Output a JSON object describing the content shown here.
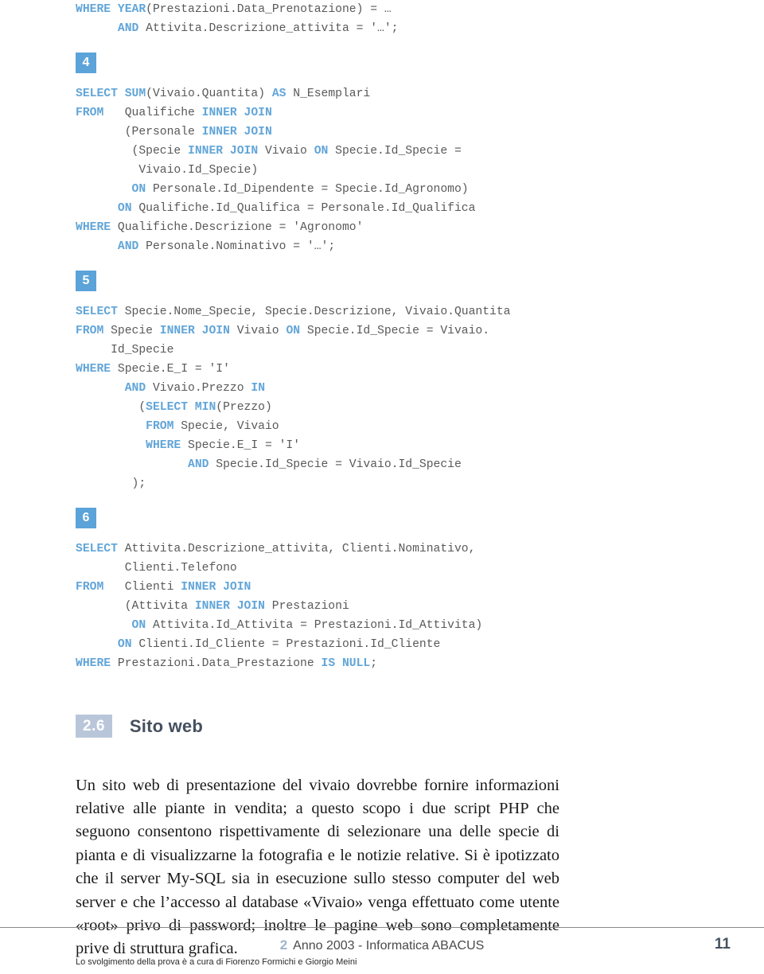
{
  "document": {
    "page_number": "11",
    "footer_chapter": "2",
    "footer_title": "Anno 2003 - Informatica ABACUS",
    "credit": "Lo svolgimento della prova è a cura di Fiorenzo Formichi e Giorgio Meini"
  },
  "colors": {
    "sql_keyword": "#61a5d8",
    "sql_text": "#59595b",
    "badge_bg": "#5ba3d9",
    "section_num_bg": "#b9c6da",
    "section_title": "#45505e",
    "page_num": "#46525f",
    "footer_chapter": "#9fb4cc",
    "rule": "#8a8a8a"
  },
  "code_blocks": [
    {
      "number": null,
      "name": "query-3-continuation",
      "lines": [
        [
          {
            "t": "WHERE",
            "k": true
          },
          {
            "t": " ",
            "k": false
          },
          {
            "t": "YEAR",
            "k": true
          },
          {
            "t": "(Prestazioni.Data_Prenotazione) = …",
            "k": false
          }
        ],
        [
          {
            "t": "      ",
            "k": false
          },
          {
            "t": "AND",
            "k": true
          },
          {
            "t": " Attivita.Descrizione_attivita = '…';",
            "k": false
          }
        ]
      ]
    },
    {
      "number": "4",
      "name": "query-4",
      "lines": [
        [
          {
            "t": "SELECT",
            "k": true
          },
          {
            "t": " ",
            "k": false
          },
          {
            "t": "SUM",
            "k": true
          },
          {
            "t": "(Vivaio.Quantita) ",
            "k": false
          },
          {
            "t": "AS",
            "k": true
          },
          {
            "t": " N_Esemplari",
            "k": false
          }
        ],
        [
          {
            "t": "FROM",
            "k": true
          },
          {
            "t": "   Qualifiche ",
            "k": false
          },
          {
            "t": "INNER JOIN",
            "k": true
          }
        ],
        [
          {
            "t": "       (Personale ",
            "k": false
          },
          {
            "t": "INNER JOIN",
            "k": true
          }
        ],
        [
          {
            "t": "        (Specie ",
            "k": false
          },
          {
            "t": "INNER JOIN",
            "k": true
          },
          {
            "t": " Vivaio ",
            "k": false
          },
          {
            "t": "ON",
            "k": true
          },
          {
            "t": " Specie.Id_Specie =",
            "k": false
          }
        ],
        [
          {
            "t": "         Vivaio.Id_Specie)",
            "k": false
          }
        ],
        [
          {
            "t": "        ",
            "k": false
          },
          {
            "t": "ON",
            "k": true
          },
          {
            "t": " Personale.Id_Dipendente = Specie.Id_Agronomo)",
            "k": false
          }
        ],
        [
          {
            "t": "      ",
            "k": false
          },
          {
            "t": "ON",
            "k": true
          },
          {
            "t": " Qualifiche.Id_Qualifica = Personale.Id_Qualifica",
            "k": false
          }
        ],
        [
          {
            "t": "WHERE",
            "k": true
          },
          {
            "t": " Qualifiche.Descrizione = 'Agronomo'",
            "k": false
          }
        ],
        [
          {
            "t": "      ",
            "k": false
          },
          {
            "t": "AND",
            "k": true
          },
          {
            "t": " Personale.Nominativo = '…';",
            "k": false
          }
        ]
      ]
    },
    {
      "number": "5",
      "name": "query-5",
      "lines": [
        [
          {
            "t": "SELECT",
            "k": true
          },
          {
            "t": " Specie.Nome_Specie, Specie.Descrizione, Vivaio.Quantita",
            "k": false
          }
        ],
        [
          {
            "t": "FROM",
            "k": true
          },
          {
            "t": " Specie ",
            "k": false
          },
          {
            "t": "INNER JOIN",
            "k": true
          },
          {
            "t": " Vivaio ",
            "k": false
          },
          {
            "t": "ON",
            "k": true
          },
          {
            "t": " Specie.Id_Specie = Vivaio.",
            "k": false
          }
        ],
        [
          {
            "t": "     Id_Specie",
            "k": false
          }
        ],
        [
          {
            "t": "WHERE",
            "k": true
          },
          {
            "t": " Specie.E_I = 'I'",
            "k": false
          }
        ],
        [
          {
            "t": "       ",
            "k": false
          },
          {
            "t": "AND",
            "k": true
          },
          {
            "t": " Vivaio.Prezzo ",
            "k": false
          },
          {
            "t": "IN",
            "k": true
          }
        ],
        [
          {
            "t": "         (",
            "k": false
          },
          {
            "t": "SELECT MIN",
            "k": true
          },
          {
            "t": "(Prezzo)",
            "k": false
          }
        ],
        [
          {
            "t": "          ",
            "k": false
          },
          {
            "t": "FROM",
            "k": true
          },
          {
            "t": " Specie, Vivaio",
            "k": false
          }
        ],
        [
          {
            "t": "          ",
            "k": false
          },
          {
            "t": "WHERE",
            "k": true
          },
          {
            "t": " Specie.E_I = 'I'",
            "k": false
          }
        ],
        [
          {
            "t": "                ",
            "k": false
          },
          {
            "t": "AND",
            "k": true
          },
          {
            "t": " Specie.Id_Specie = Vivaio.Id_Specie",
            "k": false
          }
        ],
        [
          {
            "t": "        );",
            "k": false
          }
        ]
      ]
    },
    {
      "number": "6",
      "name": "query-6",
      "lines": [
        [
          {
            "t": "SELECT",
            "k": true
          },
          {
            "t": " Attivita.Descrizione_attivita, Clienti.Nominativo,",
            "k": false
          }
        ],
        [
          {
            "t": "       Clienti.Telefono",
            "k": false
          }
        ],
        [
          {
            "t": "FROM",
            "k": true
          },
          {
            "t": "   Clienti ",
            "k": false
          },
          {
            "t": "INNER JOIN",
            "k": true
          }
        ],
        [
          {
            "t": "       (Attivita ",
            "k": false
          },
          {
            "t": "INNER JOIN",
            "k": true
          },
          {
            "t": " Prestazioni",
            "k": false
          }
        ],
        [
          {
            "t": "        ",
            "k": false
          },
          {
            "t": "ON",
            "k": true
          },
          {
            "t": " Attivita.Id_Attivita = Prestazioni.Id_Attivita)",
            "k": false
          }
        ],
        [
          {
            "t": "      ",
            "k": false
          },
          {
            "t": "ON",
            "k": true
          },
          {
            "t": " Clienti.Id_Cliente = Prestazioni.Id_Cliente",
            "k": false
          }
        ],
        [
          {
            "t": "WHERE",
            "k": true
          },
          {
            "t": " Prestazioni.Data_Prestazione ",
            "k": false
          },
          {
            "t": "IS NULL",
            "k": true
          },
          {
            "t": ";",
            "k": false
          }
        ]
      ]
    }
  ],
  "section": {
    "number": "2.6",
    "title": "Sito web",
    "paragraph": "Un sito web di presentazione del vivaio dovrebbe fornire informazioni relative alle piante in vendita; a questo scopo i due script PHP che seguono consentono rispettivamente di selezionare una delle specie di pianta e di visualizzarne la fotografia e le notizie relative. Si è ipotizzato che il server My-SQL sia in esecuzione sullo stesso computer del web server e che l’accesso al database «Vivaio» venga effettuato come utente «root» privo di password; inoltre le pagine web sono completamente prive di struttura grafica."
  }
}
